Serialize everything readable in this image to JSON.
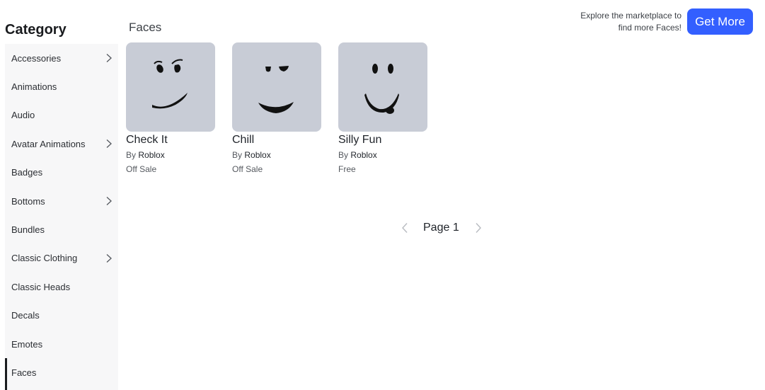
{
  "sidebar": {
    "title": "Category",
    "items": [
      {
        "label": "Accessories",
        "has_children": true
      },
      {
        "label": "Animations",
        "has_children": false
      },
      {
        "label": "Audio",
        "has_children": false
      },
      {
        "label": "Avatar Animations",
        "has_children": true
      },
      {
        "label": "Badges",
        "has_children": false
      },
      {
        "label": "Bottoms",
        "has_children": true
      },
      {
        "label": "Bundles",
        "has_children": false
      },
      {
        "label": "Classic Clothing",
        "has_children": true
      },
      {
        "label": "Classic Heads",
        "has_children": false
      },
      {
        "label": "Decals",
        "has_children": false
      },
      {
        "label": "Emotes",
        "has_children": false
      },
      {
        "label": "Faces",
        "has_children": false,
        "active": true
      }
    ]
  },
  "main": {
    "section_title": "Faces",
    "promo": {
      "line1": "Explore the marketplace to",
      "line2": "find more Faces!",
      "button_label": "Get More"
    },
    "items": [
      {
        "name": "Check It",
        "by": "By",
        "creator": "Roblox",
        "price": "Off Sale",
        "thumbnail_icon": "check-it-face-icon"
      },
      {
        "name": "Chill",
        "by": "By",
        "creator": "Roblox",
        "price": "Off Sale",
        "thumbnail_icon": "chill-face-icon"
      },
      {
        "name": "Silly Fun",
        "by": "By",
        "creator": "Roblox",
        "price": "Free",
        "thumbnail_icon": "silly-fun-face-icon"
      }
    ]
  },
  "pagination": {
    "label": "Page 1",
    "prev_icon": "chevron-left-icon",
    "next_icon": "chevron-right-icon"
  },
  "colors": {
    "accent": "#335fff",
    "sidebar_bg": "#f7f7f8",
    "thumbnail_bg": "#c8ccd6"
  }
}
